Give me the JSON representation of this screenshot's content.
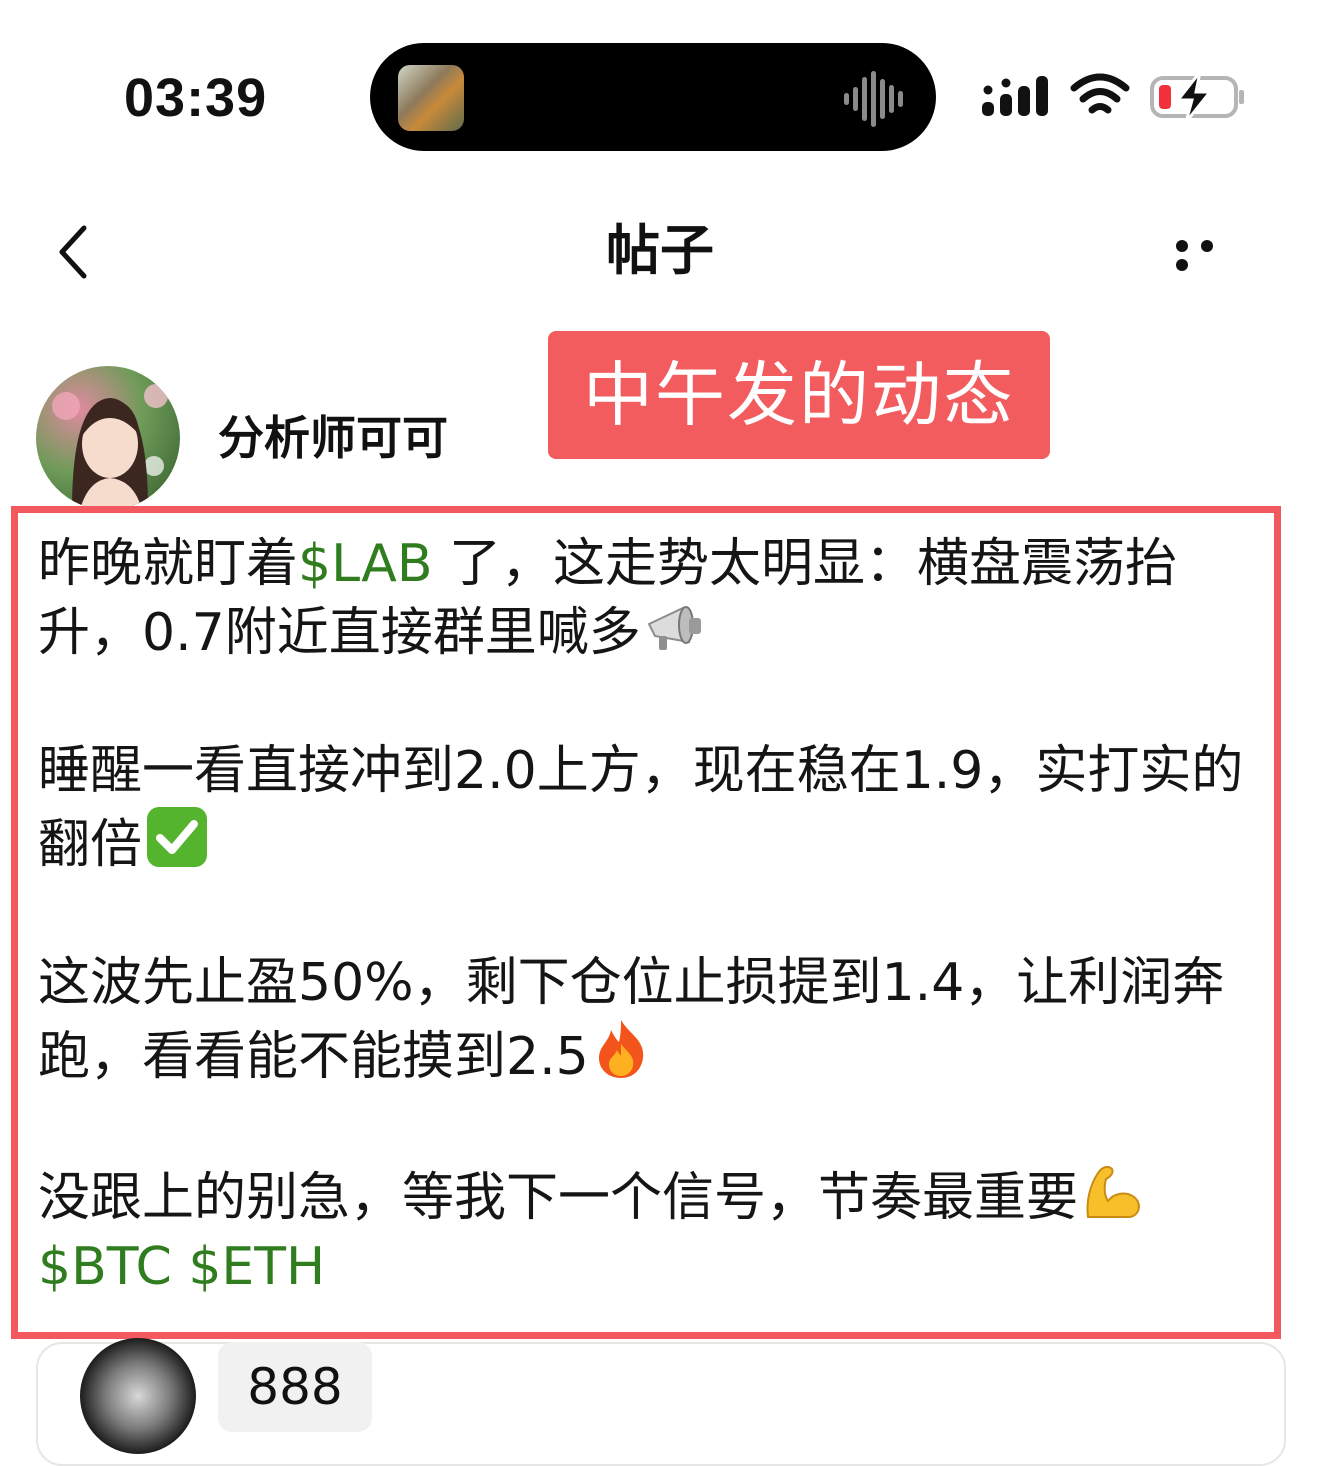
{
  "status_bar": {
    "time": "03:39",
    "island_thumbnail_icon": "media-artwork-thumbnail",
    "island_audio_icon": "audio-waveform-icon",
    "signal_icon": "cellular-signal-icon",
    "wifi_icon": "wifi-icon",
    "battery_icon": "battery-charging-low-icon",
    "battery_low_color": "#f2323a"
  },
  "nav": {
    "back_icon": "chevron-left-icon",
    "title": "帖子",
    "more_icon": "more-horizontal-icon"
  },
  "author": {
    "name": "分析师可可"
  },
  "annotation": {
    "label": "中午发的动态",
    "color": "#f25c5f"
  },
  "post": {
    "highlight_border_color": "#f2585d",
    "ticker_color": "#2f7d1e",
    "p1_before": "昨晚就盯着",
    "p1_ticker": "$LAB",
    "p1_after": " 了，这走势太明显：横盘震荡抬升，0.7附近直接群里喊多",
    "p1_emoji": "loudspeaker-emoji",
    "p2_text": "睡醒一看直接冲到2.0上方，现在稳在1.9，实打实的翻倍",
    "p2_emoji": "check-mark-emoji",
    "p3_text": "这波先止盈50%，剩下仓位止损提到1.4，让利润奔跑，看看能不能摸到2.5",
    "p3_emoji": "fire-emoji",
    "p4_text": "没跟上的别急，等我下一个信号，节奏最重要",
    "p4_emoji": "flexed-biceps-emoji",
    "tickers": [
      "$BTC",
      "$ETH"
    ]
  },
  "bottom": {
    "badge": "888"
  }
}
